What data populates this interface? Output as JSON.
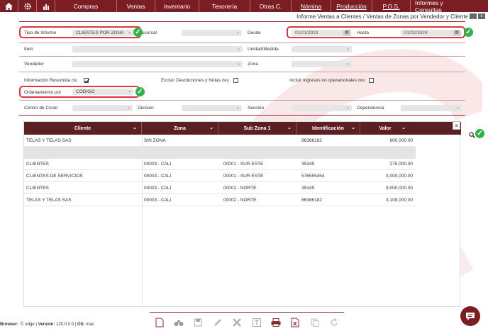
{
  "nav": {
    "items": [
      "Compras",
      "Ventas",
      "Inventario",
      "Tesorería",
      "Otras C.",
      "Nómina",
      "Producción",
      "P.O.S.",
      "Informes y Consultas"
    ]
  },
  "window": {
    "title": "Informe Ventas a Clientes / Ventas de Zonas por Vendedor y Cliente",
    "min": "_",
    "close": "x"
  },
  "form": {
    "tipo_informe_label": "Tipo de Informe",
    "tipo_informe_value": "CLIENTES POR ZONA",
    "sucursal_label": "ucursal",
    "desde_label": "Desde",
    "desde_value": "01/01/2023",
    "hasta_label": "Hasta",
    "hasta_value": "01/02/2024",
    "item_label": "Item",
    "unidad_label": "Unidad/Medida",
    "vendedor_label": "Vendedor",
    "zona_label": "Zona",
    "info_resumida_label": "Información Resumida",
    "info_resumida_hint": "(Si)",
    "excluir_label": "Excluir Devoluciones y Notas",
    "excluir_hint": "(No)",
    "incluir_label": "Incluir ingresos no operacionales",
    "incluir_hint": "(No)",
    "ordenamiento_label": "Ordenamiento por",
    "ordenamiento_value": "CÓDIGO",
    "centro_label": "Centro de Costo",
    "division_label": "División",
    "seccion_label": "Sección",
    "dependencia_label": "Dependencia"
  },
  "grid": {
    "columns": [
      "Cliente",
      "Zona",
      "Sub Zona 1",
      "Identificación",
      "Valor"
    ],
    "rows": [
      [
        "TELAS Y TELAS SAS",
        "SIN ZONA",
        "",
        "86386182",
        "800,000.00"
      ],
      [
        "",
        "",
        "",
        "",
        ""
      ],
      [
        "CLIENTES",
        "00003 - CALI",
        "00001 - SUR ESTE",
        "35345",
        "275,000.00"
      ],
      [
        "CLIENTES DE SERVICIOS",
        "00003 - CALI",
        "00001 - SUR ESTE",
        "576555454",
        "3,000,000.00"
      ],
      [
        "CLIENTES",
        "00003 - CALI",
        "00002 - NORTE",
        "35345",
        "9,000,000.00"
      ],
      [
        "TELAS Y TELAS SAS",
        "00003 - CALI",
        "00002 - NORTE",
        "86386182",
        "3,108,000.00"
      ]
    ]
  },
  "footer": {
    "browser_label": "Browser:",
    "browser_value": "edge",
    "version_label": "Versión:",
    "version_value": "120.0.0.0",
    "os_label": "OS:",
    "os_value": "mac"
  },
  "icons": [
    "gear-icon",
    "chart-icon",
    "new-document-icon",
    "binoculars-icon",
    "save-icon",
    "edit-icon",
    "delete-icon",
    "text-icon",
    "print-icon",
    "excel-icon",
    "copy-icon",
    "refresh-icon",
    "chat-icon",
    "search-icon",
    "menu-icon",
    "calendar-icon",
    "checkmark-icon"
  ],
  "colors": {
    "brand": "#7a1e24",
    "grid_header": "#5b1f24",
    "highlight": "#e0353a",
    "ok": "#2fb24a"
  }
}
